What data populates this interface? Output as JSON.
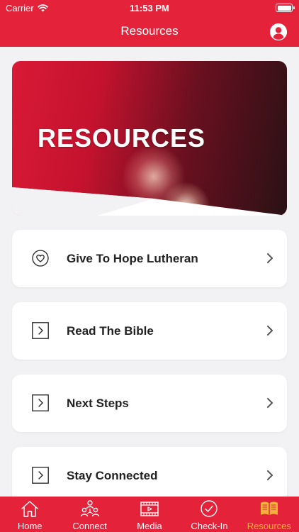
{
  "status_bar": {
    "carrier": "Carrier",
    "time": "11:53 PM"
  },
  "nav": {
    "title": "Resources"
  },
  "hero": {
    "title": "RESOURCES"
  },
  "list": [
    {
      "label": "Give To Hope Lutheran",
      "icon": "heart-circle-icon"
    },
    {
      "label": "Read The Bible",
      "icon": "play-square-icon"
    },
    {
      "label": "Next Steps",
      "icon": "play-square-icon"
    },
    {
      "label": "Stay Connected",
      "icon": "play-square-icon"
    }
  ],
  "tabs": [
    {
      "label": "Home",
      "icon": "home-icon",
      "active": false
    },
    {
      "label": "Connect",
      "icon": "people-icon",
      "active": false
    },
    {
      "label": "Media",
      "icon": "media-icon",
      "active": false
    },
    {
      "label": "Check-In",
      "icon": "checkmark-circle-icon",
      "active": false
    },
    {
      "label": "Resources",
      "icon": "book-icon",
      "active": true
    }
  ],
  "colors": {
    "brand": "#e4223a",
    "active_tab": "#f5b13c",
    "background": "#f2f2f4"
  }
}
